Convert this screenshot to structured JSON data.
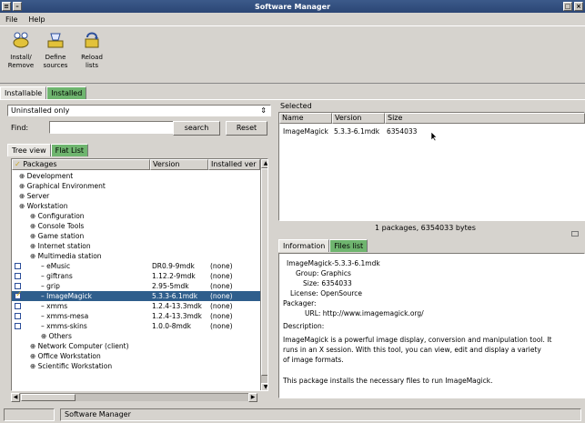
{
  "window": {
    "title": "Software Manager"
  },
  "menu": [
    "File",
    "Help"
  ],
  "toolbar": [
    {
      "label_line1": "Install/",
      "label_line2": "Remove",
      "icon": "install-remove-icon"
    },
    {
      "label_line1": "Define",
      "label_line2": "sources",
      "icon": "define-sources-icon"
    },
    {
      "label_line1": "Reload",
      "label_line2": "lists",
      "icon": "reload-lists-icon"
    }
  ],
  "top_tabs": [
    "Installable",
    "Installed"
  ],
  "filter": {
    "selected": "Uninstalled only"
  },
  "find": {
    "label": "Find:",
    "value": "",
    "search_label": "search",
    "reset_label": "Reset"
  },
  "view_tabs": [
    "Tree view",
    "Flat List"
  ],
  "tree": {
    "columns": [
      "Packages",
      "Version",
      "Installed ver"
    ],
    "rows": [
      {
        "indent": 0,
        "name": "Development",
        "version": "",
        "installed": "",
        "checkbox": false
      },
      {
        "indent": 0,
        "name": "Graphical Environment",
        "version": "",
        "installed": "",
        "checkbox": false
      },
      {
        "indent": 0,
        "name": "Server",
        "version": "",
        "installed": "",
        "checkbox": false
      },
      {
        "indent": 0,
        "name": "Workstation",
        "version": "",
        "installed": "",
        "checkbox": false
      },
      {
        "indent": 1,
        "name": "Configuration",
        "version": "",
        "installed": "",
        "checkbox": false
      },
      {
        "indent": 1,
        "name": "Console Tools",
        "version": "",
        "installed": "",
        "checkbox": false
      },
      {
        "indent": 1,
        "name": "Game station",
        "version": "",
        "installed": "",
        "checkbox": false
      },
      {
        "indent": 1,
        "name": "Internet station",
        "version": "",
        "installed": "",
        "checkbox": false
      },
      {
        "indent": 1,
        "name": "Multimedia station",
        "version": "",
        "installed": "",
        "checkbox": false
      },
      {
        "indent": 2,
        "name": "eMusic",
        "version": "DR0.9-9mdk",
        "installed": "(none)",
        "checkbox": true,
        "checked": false
      },
      {
        "indent": 2,
        "name": "giftrans",
        "version": "1.12.2-9mdk",
        "installed": "(none)",
        "checkbox": true,
        "checked": false
      },
      {
        "indent": 2,
        "name": "grip",
        "version": "2.95-5mdk",
        "installed": "(none)",
        "checkbox": true,
        "checked": false
      },
      {
        "indent": 2,
        "name": "ImageMagick",
        "version": "5.3.3-6.1mdk",
        "installed": "(none)",
        "checkbox": true,
        "checked": true,
        "selected": true
      },
      {
        "indent": 2,
        "name": "xmms",
        "version": "1.2.4-13.3mdk",
        "installed": "(none)",
        "checkbox": true,
        "checked": false
      },
      {
        "indent": 2,
        "name": "xmms-mesa",
        "version": "1.2.4-13.3mdk",
        "installed": "(none)",
        "checkbox": true,
        "checked": false
      },
      {
        "indent": 2,
        "name": "xmms-skins",
        "version": "1.0.0-8mdk",
        "installed": "(none)",
        "checkbox": true,
        "checked": false
      },
      {
        "indent": 2,
        "name": "Others",
        "version": "",
        "installed": "",
        "checkbox": false
      },
      {
        "indent": 1,
        "name": "Network Computer (client)",
        "version": "",
        "installed": "",
        "checkbox": false
      },
      {
        "indent": 1,
        "name": "Office Workstation",
        "version": "",
        "installed": "",
        "checkbox": false
      },
      {
        "indent": 1,
        "name": "Scientific Workstation",
        "version": "",
        "installed": "",
        "checkbox": false
      }
    ]
  },
  "selected_panel": {
    "title": "Selected",
    "columns": [
      "Name",
      "Version",
      "Size"
    ],
    "rows": [
      {
        "name": "ImageMagick",
        "version": "5.3.3-6.1mdk",
        "size": "6354033"
      }
    ],
    "summary": "1 packages, 6354033 bytes"
  },
  "info_tabs": [
    "Information",
    "Files list"
  ],
  "info": {
    "package_full": "ImageMagick-5.3.3-6.1mdk",
    "group_label": "Group:",
    "group": "Graphics",
    "size_label": "Size:",
    "size": "6354033",
    "license_label": "License:",
    "license": "OpenSource",
    "packager_label": "Packager:",
    "url_label": "URL:",
    "url": "http://www.imagemagick.org/",
    "description_label": "Description:",
    "desc1": "ImageMagick is a powerful image display, conversion and manipulation tool. It",
    "desc2": "runs in an X session. With this tool, you can view, edit and display a variety",
    "desc3": "of image formats.",
    "desc4": "This package installs the necessary files to run ImageMagick."
  },
  "status": {
    "text": "Software Manager"
  },
  "colors": {
    "titlebar": "#2b4675",
    "selection": "#2f5e8c",
    "active_tab": "#6fb56f",
    "check": "#2b4e9a"
  }
}
